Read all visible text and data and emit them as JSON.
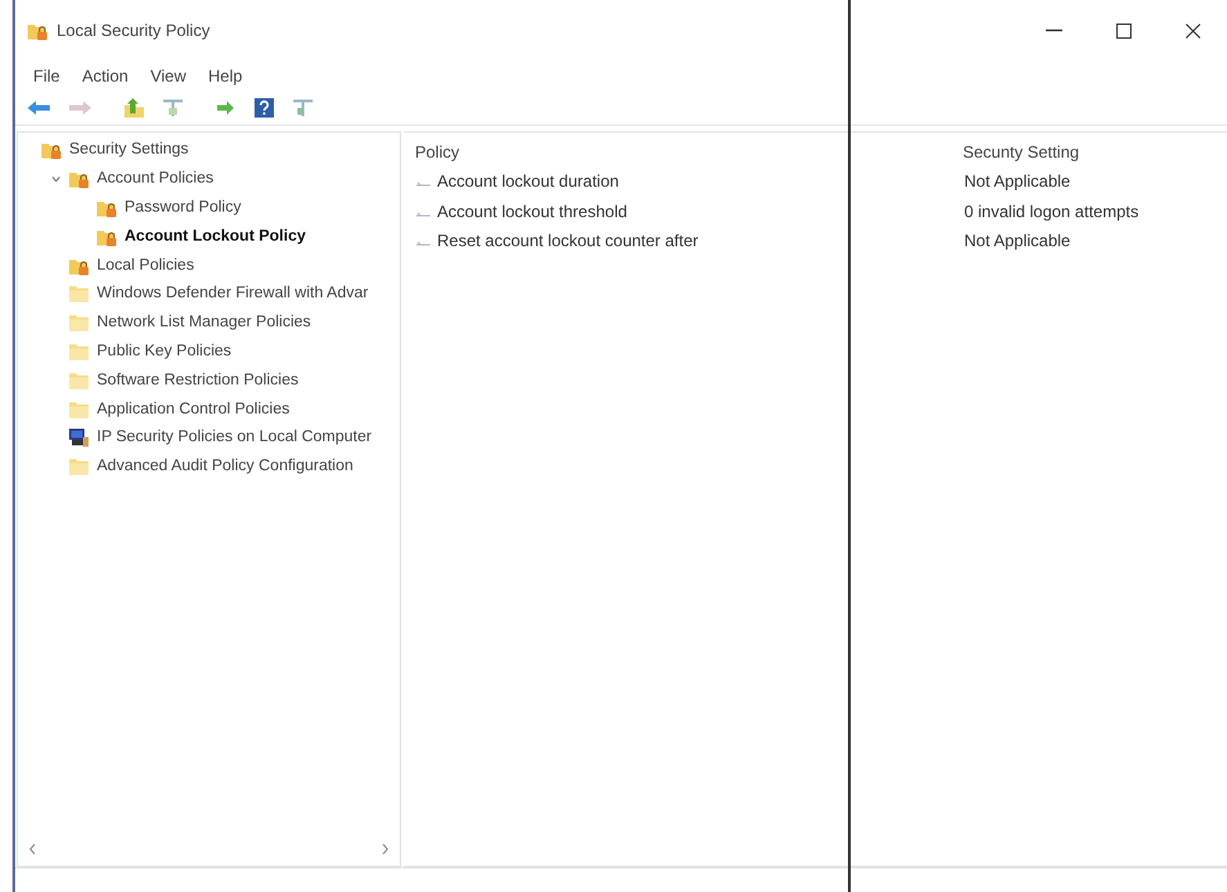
{
  "window": {
    "title": "Local Security Policy"
  },
  "menu": [
    "File",
    "Action",
    "View",
    "Help"
  ],
  "toolbar": [
    {
      "kind": "back",
      "disabled": false
    },
    {
      "kind": "forward",
      "disabled": true
    },
    {
      "kind": "up",
      "disabled": false
    },
    {
      "kind": "tree",
      "disabled": false
    },
    {
      "kind": "export",
      "disabled": false
    },
    {
      "kind": "help",
      "disabled": false
    },
    {
      "kind": "pane",
      "disabled": false
    }
  ],
  "tree": [
    {
      "label": "Security Settings",
      "kind": "lock-folder",
      "selected": false,
      "children": [
        {
          "label": "Account Policies",
          "kind": "lock-folder",
          "selected": false,
          "expanded": true,
          "children": [
            {
              "label": "Password Policy",
              "kind": "lock-folder",
              "selected": false
            },
            {
              "label": "Account Lockout Policy",
              "kind": "lock-folder",
              "selected": true
            }
          ]
        },
        {
          "label": "Local Policies",
          "kind": "lock-folder",
          "selected": false
        },
        {
          "label": "Windows Defender Firewall with Advar",
          "kind": "folder",
          "selected": false
        },
        {
          "label": "Network List Manager Policies",
          "kind": "folder",
          "selected": false
        },
        {
          "label": "Public Key Policies",
          "kind": "folder",
          "selected": false
        },
        {
          "label": "Software Restriction Policies",
          "kind": "folder",
          "selected": false
        },
        {
          "label": "Application Control Policies",
          "kind": "folder",
          "selected": false
        },
        {
          "label": "IP Security Policies on Local Computer",
          "kind": "computer",
          "selected": false
        },
        {
          "label": "Advanced Audit Policy Configuration",
          "kind": "folder",
          "selected": false
        }
      ]
    }
  ],
  "table": {
    "columns": [
      "Policy",
      "Secunty Setting"
    ],
    "rows": [
      [
        "Account lockout duration",
        "Not Applicable"
      ],
      [
        "Account lockout threshold",
        "0 invalid logon attempts"
      ],
      [
        "Reset account lockout counter after",
        "Not Applicable"
      ]
    ]
  }
}
